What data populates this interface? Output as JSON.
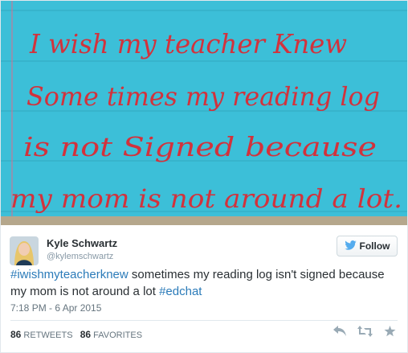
{
  "photo": {
    "lines": [
      "I wish my teacher Knew",
      "Some times my reading log",
      "is not Signed because",
      "my mom is not around a lot."
    ],
    "card_color": "#3cbfd8",
    "ink_color": "#d2323c"
  },
  "tweet": {
    "user_name": "Kyle Schwartz",
    "user_handle": "@kylemschwartz",
    "follow_label": "Follow",
    "hashtag_1": "#iwishmyteacherknew",
    "body_text": " sometimes my reading log isn't signed because my mom is not around a lot ",
    "hashtag_2": "#edchat",
    "timestamp": "7:18 PM - 6 Apr 2015",
    "retweets_count": "86",
    "retweets_label": "RETWEETS",
    "favorites_count": "86",
    "favorites_label": "FAVORITES",
    "link_color": "#2b7bb9"
  },
  "icons": {
    "follow": "twitter-bird-icon",
    "reply": "reply-icon",
    "retweet": "retweet-icon",
    "favorite": "star-icon"
  }
}
